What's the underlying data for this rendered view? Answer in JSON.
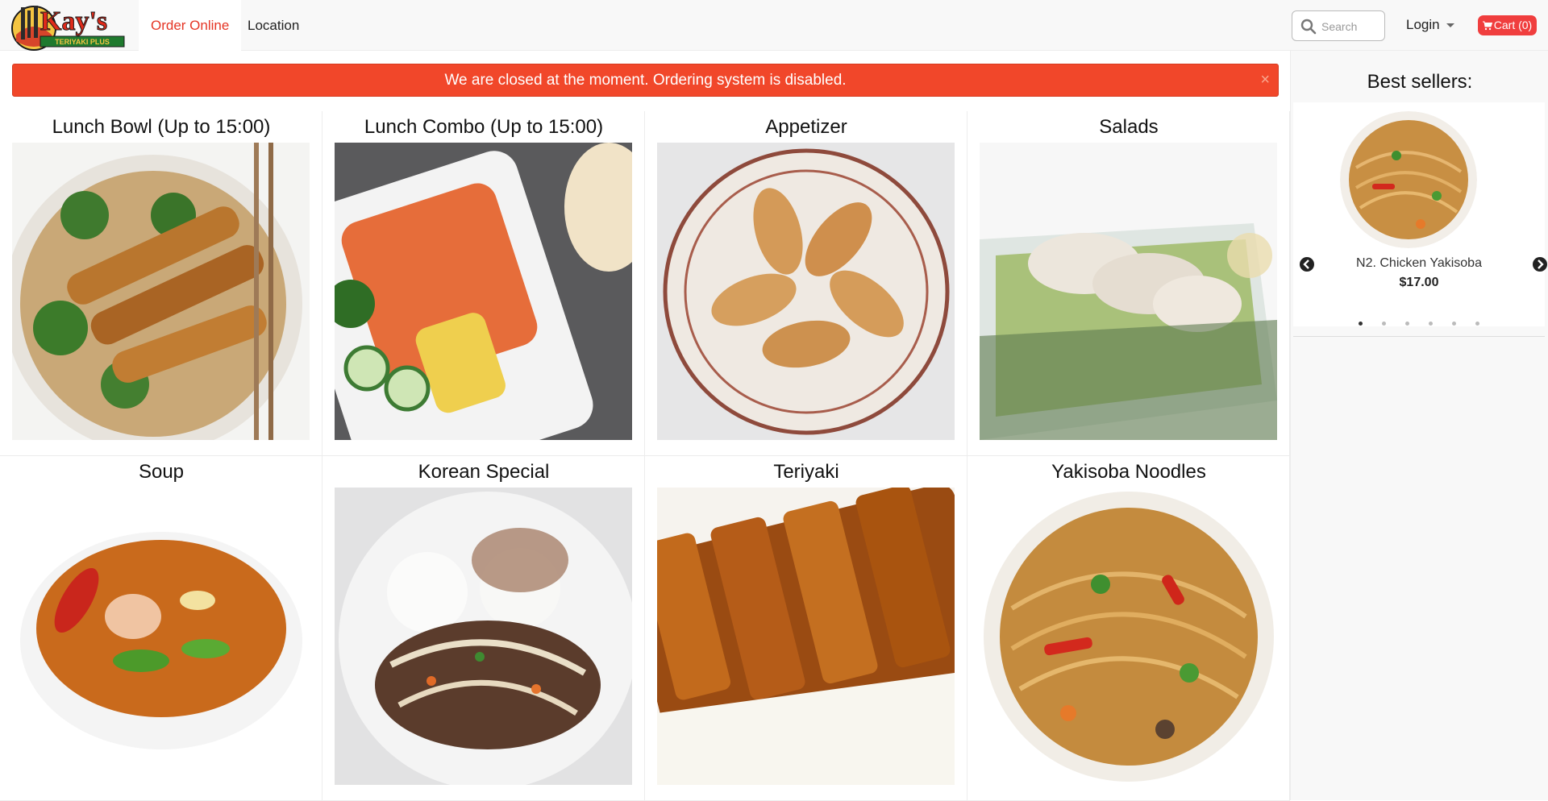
{
  "brand": {
    "name": "Kay's",
    "tagline": "TERIYAKI PLUS"
  },
  "nav": {
    "links": [
      "Order Online",
      "Location"
    ]
  },
  "header": {
    "search_placeholder": "Search",
    "login_label": "Login",
    "cart_label": "Cart (0)"
  },
  "alert": {
    "message": "We are closed at the moment. Ordering system is disabled.",
    "close": "×"
  },
  "categories": [
    {
      "title": "Lunch Bowl (Up to 15:00)"
    },
    {
      "title": "Lunch Combo (Up to 15:00)"
    },
    {
      "title": "Appetizer"
    },
    {
      "title": "Salads"
    },
    {
      "title": "Soup"
    },
    {
      "title": "Korean Special"
    },
    {
      "title": "Teriyaki"
    },
    {
      "title": "Yakisoba Noodles"
    }
  ],
  "sidebar": {
    "title": "Best sellers:",
    "product": {
      "name": "N2. Chicken Yakisoba",
      "price": "$17.00"
    },
    "carousel": {
      "slide_count": 6,
      "active_slide": 1
    }
  },
  "colors": {
    "accent": "#e53525",
    "alert_bg": "#f1472a",
    "cart_bg": "#f03e3e"
  },
  "icons": [
    "search-icon",
    "caret-down-icon",
    "cart-icon",
    "close-icon",
    "chevron-left-icon",
    "chevron-right-icon"
  ]
}
